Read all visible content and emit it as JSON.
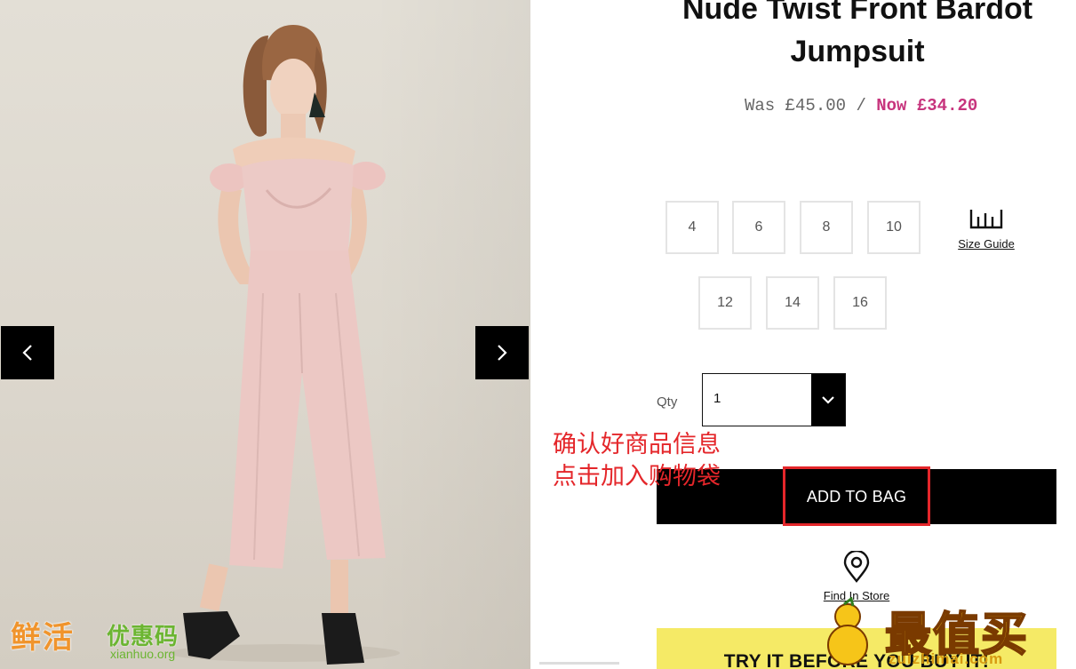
{
  "product": {
    "title_line1": "Nude Twist Front Bardot",
    "title_line2": "Jumpsuit",
    "price": {
      "was_label": "Was £45.00",
      "separator": "/",
      "now_label": "Now £34.20"
    }
  },
  "gallery": {
    "prev_icon": "chevron-left-icon",
    "next_icon": "chevron-right-icon"
  },
  "sizes": {
    "row1": [
      "4",
      "6",
      "8",
      "10"
    ],
    "row2": [
      "12",
      "14",
      "16"
    ],
    "size_guide_label": "Size Guide",
    "size_guide_icon": "ruler-icon"
  },
  "quantity": {
    "label": "Qty",
    "value": "1",
    "chevron_icon": "chevron-down-icon"
  },
  "actions": {
    "add_to_bag_label": "ADD TO BAG",
    "find_in_store_label": "Find In Store",
    "find_in_store_icon": "location-pin-icon"
  },
  "banner": {
    "label": "TRY IT BEFORE YOU BUY IT!"
  },
  "annotation": {
    "line1": "确认好商品信息",
    "line2": "点击加入购物袋",
    "color": "#e4262a"
  },
  "watermarks": {
    "left_brand_a": "鲜活",
    "left_brand_b": "优惠码",
    "left_domain": "xianhuo.org",
    "right_brand": "最值买",
    "right_domain": "zuizhimai.com"
  },
  "colors": {
    "sale_price": "#c7347d",
    "button_bg": "#000000",
    "banner_bg": "#f5ea66"
  }
}
